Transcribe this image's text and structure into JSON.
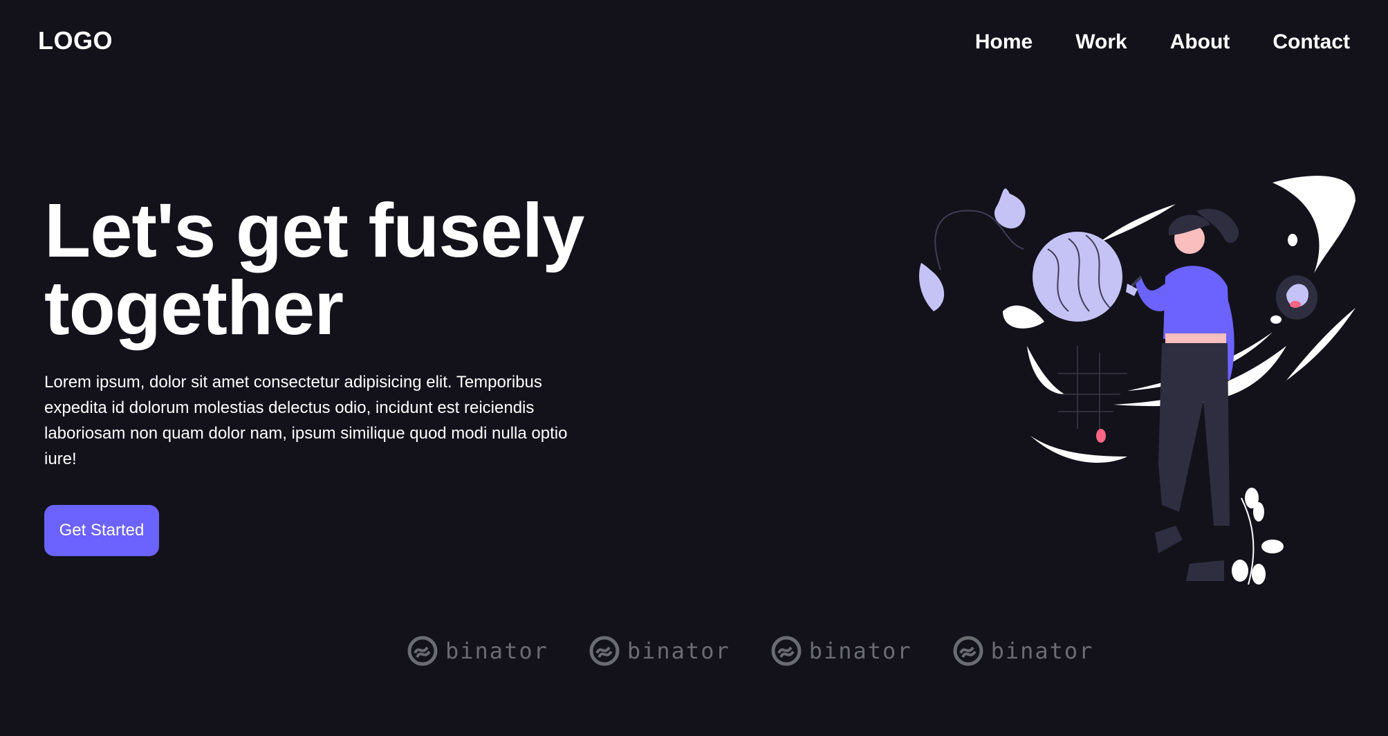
{
  "header": {
    "logo": "LOGO",
    "nav": [
      {
        "label": "Home"
      },
      {
        "label": "Work"
      },
      {
        "label": "About"
      },
      {
        "label": "Contact"
      }
    ]
  },
  "hero": {
    "title_line1": "Let's get fusely",
    "title_line2": "together",
    "description": "Lorem ipsum, dolor sit amet consectetur adipisicing elit. Temporibus expedita id dolorum molestias delectus odio, incidunt est reiciendis laboriosam non quam dolor nam, ipsum similique quod modi nulla optio iure!",
    "cta_label": "Get Started"
  },
  "brands": [
    {
      "name": "binator"
    },
    {
      "name": "binator"
    },
    {
      "name": "binator"
    },
    {
      "name": "binator"
    }
  ],
  "colors": {
    "background": "#13121b",
    "accent": "#6c63ff",
    "brand_gray": "#6b6b72",
    "lavender": "#c5c2f6"
  }
}
